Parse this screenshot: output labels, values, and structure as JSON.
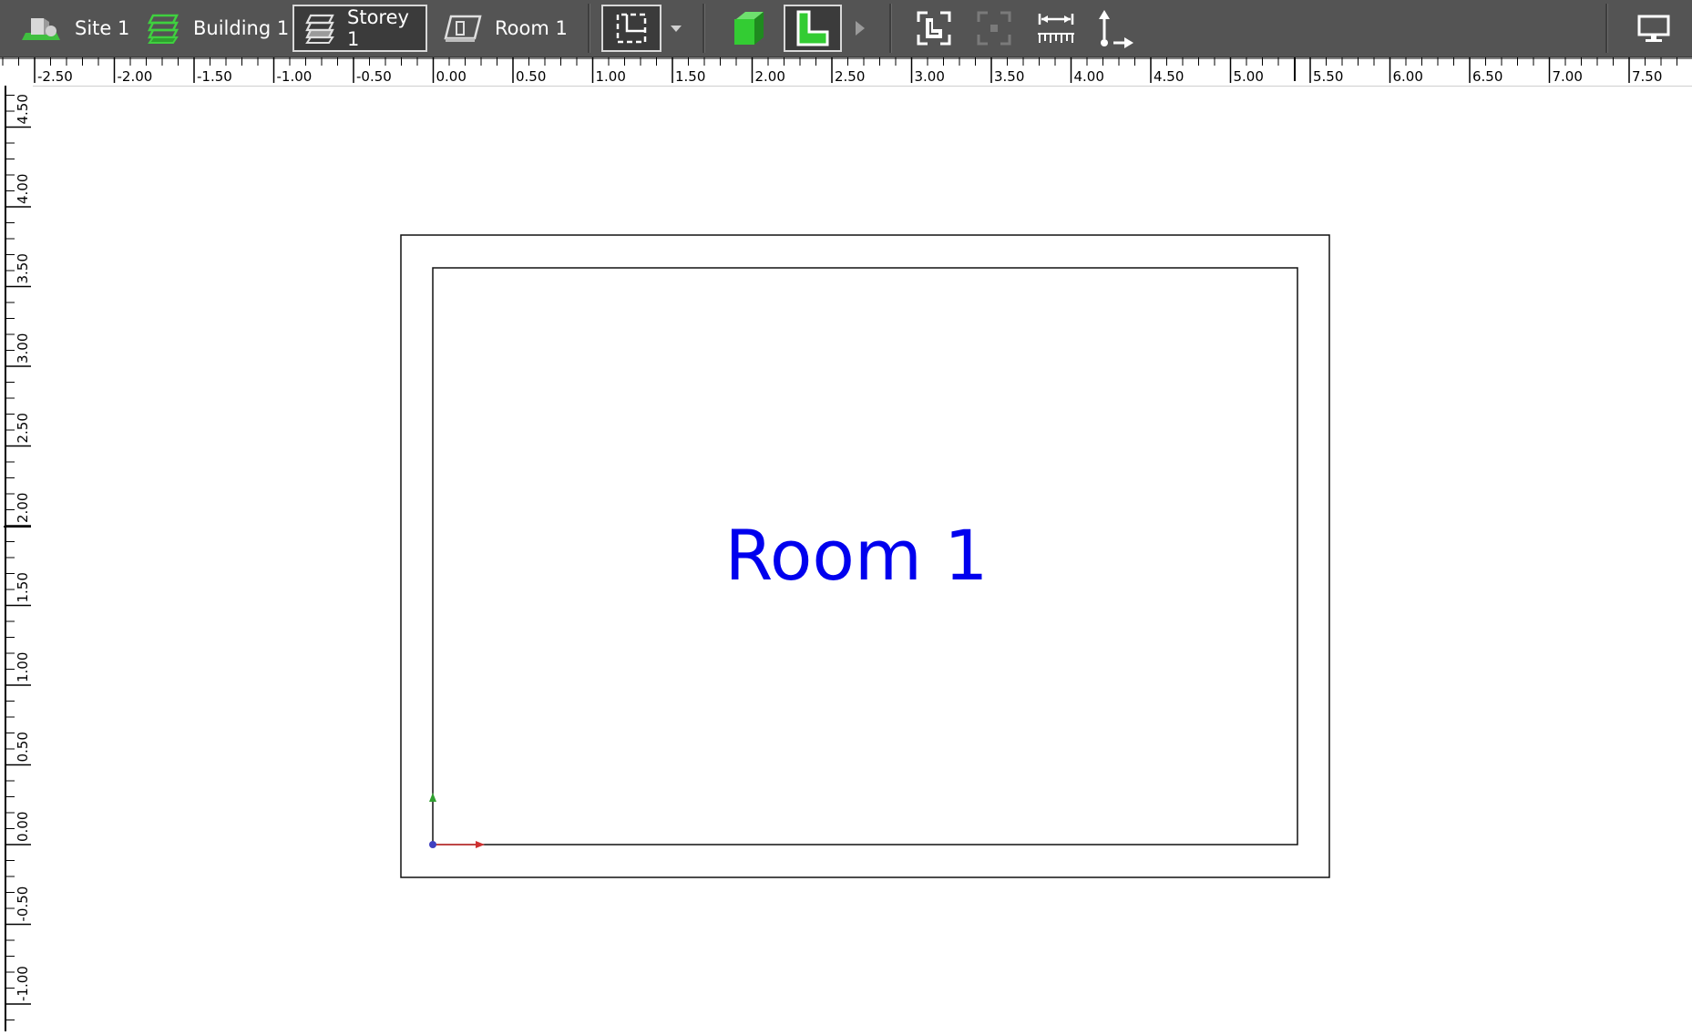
{
  "breadcrumb": {
    "site": "Site 1",
    "building": "Building 1",
    "storey": "Storey 1",
    "room": "Room 1"
  },
  "toolbar": {
    "icons": [
      "floorplan-select-icon",
      "dropdown-arrow-icon",
      "3d-view-icon",
      "floorplan-2d-icon",
      "play-arrow-icon",
      "fit-view-icon",
      "fit-selection-icon",
      "measure-tool-icon",
      "axis-origin-icon",
      "display-icon"
    ],
    "active_crumb": "Storey 1",
    "active_view": "floorplan-2d"
  },
  "rulers": {
    "top_labels": [
      "-2.50",
      "-2.00",
      "-1.50",
      "-1.00",
      "-0.50",
      "0.00",
      "0.50",
      "1.00",
      "1.50",
      "2.00",
      "2.50",
      "3.00",
      "3.50",
      "4.00",
      "4.50",
      "5.00",
      "5.50",
      "6.00",
      "6.50",
      "7.00",
      "7.50"
    ],
    "left_labels": [
      "4.50",
      "4.00",
      "3.50",
      "3.00",
      "2.50",
      "2.00",
      "1.50",
      "1.00",
      "0.50",
      "0.00",
      "-0.50",
      "-1.00"
    ]
  },
  "plan": {
    "room_label": "Room 1"
  },
  "colors": {
    "toolbar_bg": "#545454",
    "room_label": "#0000ee",
    "axis_x": "#d03030",
    "axis_y": "#30a030",
    "axis_origin": "#4040c0",
    "icon_green": "#33cc33"
  }
}
